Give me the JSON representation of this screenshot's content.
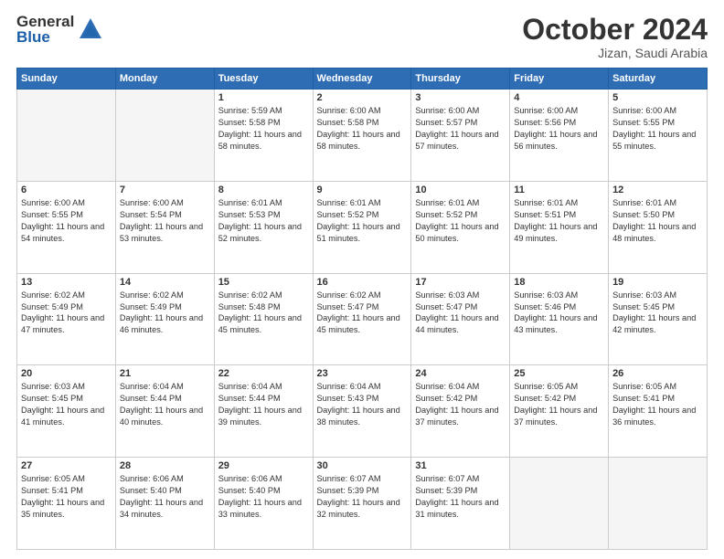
{
  "header": {
    "logo_general": "General",
    "logo_blue": "Blue",
    "month_title": "October 2024",
    "location": "Jizan, Saudi Arabia"
  },
  "days_of_week": [
    "Sunday",
    "Monday",
    "Tuesday",
    "Wednesday",
    "Thursday",
    "Friday",
    "Saturday"
  ],
  "weeks": [
    [
      {
        "day": "",
        "empty": true
      },
      {
        "day": "",
        "empty": true
      },
      {
        "day": "1",
        "sunrise": "5:59 AM",
        "sunset": "5:58 PM",
        "daylight": "11 hours and 58 minutes."
      },
      {
        "day": "2",
        "sunrise": "6:00 AM",
        "sunset": "5:58 PM",
        "daylight": "11 hours and 58 minutes."
      },
      {
        "day": "3",
        "sunrise": "6:00 AM",
        "sunset": "5:57 PM",
        "daylight": "11 hours and 57 minutes."
      },
      {
        "day": "4",
        "sunrise": "6:00 AM",
        "sunset": "5:56 PM",
        "daylight": "11 hours and 56 minutes."
      },
      {
        "day": "5",
        "sunrise": "6:00 AM",
        "sunset": "5:55 PM",
        "daylight": "11 hours and 55 minutes."
      }
    ],
    [
      {
        "day": "6",
        "sunrise": "6:00 AM",
        "sunset": "5:55 PM",
        "daylight": "11 hours and 54 minutes."
      },
      {
        "day": "7",
        "sunrise": "6:00 AM",
        "sunset": "5:54 PM",
        "daylight": "11 hours and 53 minutes."
      },
      {
        "day": "8",
        "sunrise": "6:01 AM",
        "sunset": "5:53 PM",
        "daylight": "11 hours and 52 minutes."
      },
      {
        "day": "9",
        "sunrise": "6:01 AM",
        "sunset": "5:52 PM",
        "daylight": "11 hours and 51 minutes."
      },
      {
        "day": "10",
        "sunrise": "6:01 AM",
        "sunset": "5:52 PM",
        "daylight": "11 hours and 50 minutes."
      },
      {
        "day": "11",
        "sunrise": "6:01 AM",
        "sunset": "5:51 PM",
        "daylight": "11 hours and 49 minutes."
      },
      {
        "day": "12",
        "sunrise": "6:01 AM",
        "sunset": "5:50 PM",
        "daylight": "11 hours and 48 minutes."
      }
    ],
    [
      {
        "day": "13",
        "sunrise": "6:02 AM",
        "sunset": "5:49 PM",
        "daylight": "11 hours and 47 minutes."
      },
      {
        "day": "14",
        "sunrise": "6:02 AM",
        "sunset": "5:49 PM",
        "daylight": "11 hours and 46 minutes."
      },
      {
        "day": "15",
        "sunrise": "6:02 AM",
        "sunset": "5:48 PM",
        "daylight": "11 hours and 45 minutes."
      },
      {
        "day": "16",
        "sunrise": "6:02 AM",
        "sunset": "5:47 PM",
        "daylight": "11 hours and 45 minutes."
      },
      {
        "day": "17",
        "sunrise": "6:03 AM",
        "sunset": "5:47 PM",
        "daylight": "11 hours and 44 minutes."
      },
      {
        "day": "18",
        "sunrise": "6:03 AM",
        "sunset": "5:46 PM",
        "daylight": "11 hours and 43 minutes."
      },
      {
        "day": "19",
        "sunrise": "6:03 AM",
        "sunset": "5:45 PM",
        "daylight": "11 hours and 42 minutes."
      }
    ],
    [
      {
        "day": "20",
        "sunrise": "6:03 AM",
        "sunset": "5:45 PM",
        "daylight": "11 hours and 41 minutes."
      },
      {
        "day": "21",
        "sunrise": "6:04 AM",
        "sunset": "5:44 PM",
        "daylight": "11 hours and 40 minutes."
      },
      {
        "day": "22",
        "sunrise": "6:04 AM",
        "sunset": "5:44 PM",
        "daylight": "11 hours and 39 minutes."
      },
      {
        "day": "23",
        "sunrise": "6:04 AM",
        "sunset": "5:43 PM",
        "daylight": "11 hours and 38 minutes."
      },
      {
        "day": "24",
        "sunrise": "6:04 AM",
        "sunset": "5:42 PM",
        "daylight": "11 hours and 37 minutes."
      },
      {
        "day": "25",
        "sunrise": "6:05 AM",
        "sunset": "5:42 PM",
        "daylight": "11 hours and 37 minutes."
      },
      {
        "day": "26",
        "sunrise": "6:05 AM",
        "sunset": "5:41 PM",
        "daylight": "11 hours and 36 minutes."
      }
    ],
    [
      {
        "day": "27",
        "sunrise": "6:05 AM",
        "sunset": "5:41 PM",
        "daylight": "11 hours and 35 minutes."
      },
      {
        "day": "28",
        "sunrise": "6:06 AM",
        "sunset": "5:40 PM",
        "daylight": "11 hours and 34 minutes."
      },
      {
        "day": "29",
        "sunrise": "6:06 AM",
        "sunset": "5:40 PM",
        "daylight": "11 hours and 33 minutes."
      },
      {
        "day": "30",
        "sunrise": "6:07 AM",
        "sunset": "5:39 PM",
        "daylight": "11 hours and 32 minutes."
      },
      {
        "day": "31",
        "sunrise": "6:07 AM",
        "sunset": "5:39 PM",
        "daylight": "11 hours and 31 minutes."
      },
      {
        "day": "",
        "empty": true
      },
      {
        "day": "",
        "empty": true
      }
    ]
  ]
}
